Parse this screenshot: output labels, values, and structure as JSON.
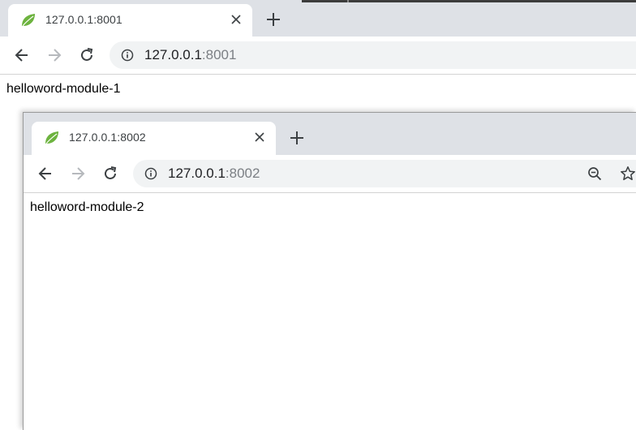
{
  "window_back": {
    "tab": {
      "title": "127.0.0.1:8001",
      "favicon": "spring-leaf-icon"
    },
    "address_bar": {
      "host": "127.0.0.1",
      "port": ":8001"
    },
    "page": {
      "text": "helloword-module-1"
    }
  },
  "window_front": {
    "tab": {
      "title": "127.0.0.1:8002",
      "favicon": "spring-leaf-icon"
    },
    "address_bar": {
      "host": "127.0.0.1",
      "port": ":8002"
    },
    "page": {
      "text": "helloword-module-2"
    }
  },
  "icons": {
    "back": "arrow-left-icon",
    "forward": "arrow-right-icon",
    "reload": "reload-icon",
    "info": "info-icon",
    "close": "close-icon",
    "new_tab": "plus-icon",
    "zoom": "zoom-out-icon",
    "bookmark": "star-icon"
  },
  "colors": {
    "tabstrip": "#dee1e6",
    "omnibox": "#f1f3f4",
    "favicon": "#6db33f"
  }
}
